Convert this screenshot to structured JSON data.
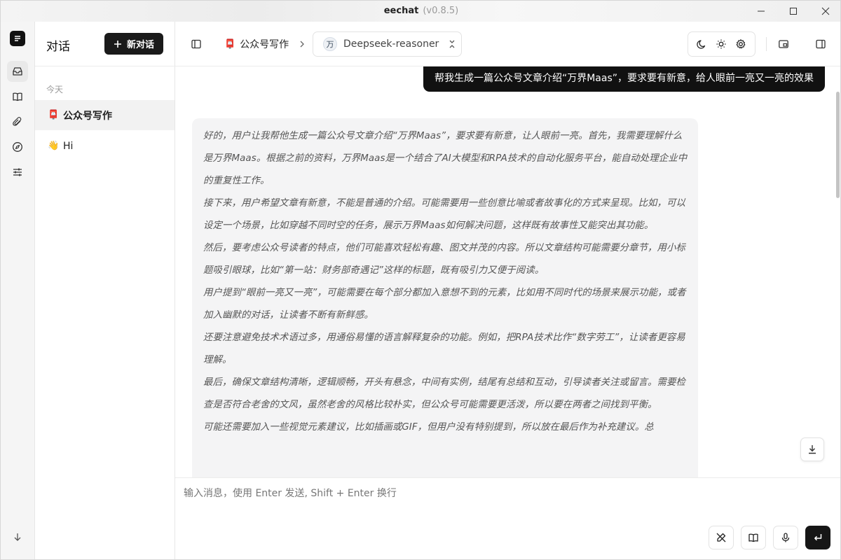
{
  "window": {
    "app_name": "eechat",
    "version": "(v0.8.5)"
  },
  "sidebar": {
    "title": "对话",
    "new_chat_label": "新对话",
    "group_label": "今天",
    "conversations": [
      {
        "emoji": "📮",
        "label": "公众号写作",
        "active": true
      },
      {
        "emoji": "👋",
        "label": "Hi",
        "active": false
      }
    ]
  },
  "topbar": {
    "crumb_emoji": "📮",
    "crumb_label": "公众号写作",
    "model_avatar": "万",
    "model_name": "Deepseek-reasoner"
  },
  "chat": {
    "user_message": "帮我生成一篇公众号文章介绍“万界Maas”，要求要有新意，给人眼前一亮又一亮的效果",
    "assistant_paragraphs": [
      "好的，用户让我帮他生成一篇公众号文章介绍“万界Maas”，要求要有新意，让人眼前一亮。首先，我需要理解什么是万界Maas。根据之前的资料，万界Maas是一个结合了AI大模型和RPA技术的自动化服务平台，能自动处理企业中的重复性工作。",
      "接下来，用户希望文章有新意，不能是普通的介绍。可能需要用一些创意比喻或者故事化的方式来呈现。比如，可以设定一个场景，比如穿越不同时空的任务，展示万界Maas如何解决问题，这样既有故事性又能突出其功能。",
      "然后，要考虑公众号读者的特点，他们可能喜欢轻松有趣、图文并茂的内容。所以文章结构可能需要分章节，用小标题吸引眼球，比如“第一站：财务部奇遇记”这样的标题，既有吸引力又便于阅读。",
      "用户提到“眼前一亮又一亮”，可能需要在每个部分都加入意想不到的元素，比如用不同时代的场景来展示功能，或者加入幽默的对话，让读者不断有新鲜感。",
      "还要注意避免技术术语过多，用通俗易懂的语言解释复杂的功能。例如，把RPA技术比作“数字劳工”，让读者更容易理解。",
      "最后，确保文章结构清晰，逻辑顺畅，开头有悬念，中间有实例，结尾有总结和互动，引导读者关注或留言。需要检查是否符合老舍的文风，虽然老舍的风格比较朴实，但公众号可能需要更活泼，所以要在两者之间找到平衡。",
      "可能还需要加入一些视觉元素建议，比如插画或GIF，但用户没有特别提到，所以放在最后作为补充建议。总"
    ]
  },
  "composer": {
    "placeholder": "输入消息，使用 Enter 发送, Shift + Enter 换行"
  },
  "icons": {
    "rail": [
      "logo-icon",
      "inbox-icon",
      "book-icon",
      "attachment-icon",
      "compass-icon",
      "sliders-icon",
      "arrow-down-icon"
    ],
    "topbar": [
      "sidebar-toggle-icon",
      "chevron-right-icon",
      "swap-icon",
      "moon-icon",
      "sun-icon",
      "gear-icon",
      "window-icon",
      "panel-right-icon"
    ],
    "composer": [
      "no-pen-icon",
      "book-icon",
      "mic-icon",
      "enter-icon"
    ]
  }
}
